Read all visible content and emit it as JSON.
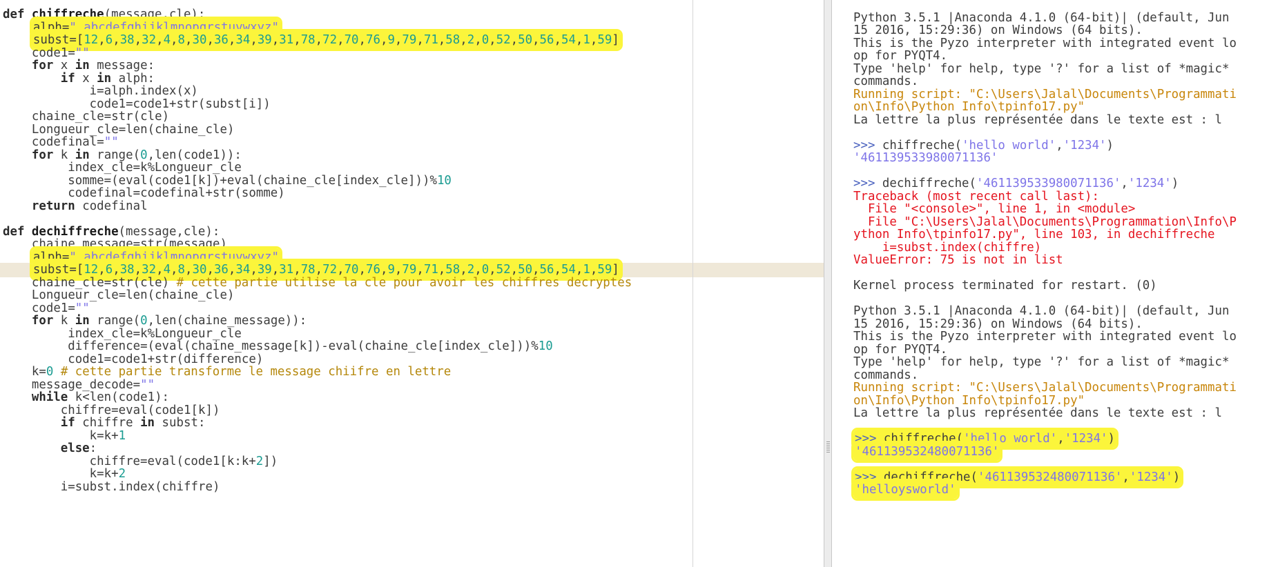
{
  "editor": {
    "lines": [
      "def chiffreche(message,cle):",
      "    alph=\" abcdefghijklmnopqrstuvwxyz\"",
      "    subst=[12,6,38,32,4,8,30,36,34,39,31,78,72,70,76,9,79,71,58,2,0,52,50,56,54,1,59]",
      "    code1=\"\"",
      "    for x in message:",
      "        if x in alph:",
      "            i=alph.index(x)",
      "            code1=code1+str(subst[i])",
      "    chaine_cle=str(cle)",
      "    Longueur_cle=len(chaine_cle)",
      "    codefinal=\"\"",
      "    for k in range(0,len(code1)):",
      "         index_cle=k%Longueur_cle",
      "         somme=(eval(code1[k])+eval(chaine_cle[index_cle]))%10",
      "         codefinal=codefinal+str(somme)",
      "    return codefinal",
      "",
      "def dechiffreche(message,cle):",
      "    chaine_message=str(message)",
      "    alph=\" abcdefghijklmnopqrstuvwxyz\"",
      "    subst=[12,6,38,32,4,8,30,36,34,39,31,78,72,70,76,9,79,71,58,2,0,52,50,56,54,1,59]",
      "    chaine_cle=str(cle) # cette partie utilise la cle pour avoir les chiffres decryptes",
      "    Longueur_cle=len(chaine_cle)",
      "    code1=\"\"",
      "    for k in range(0,len(chaine_message)):",
      "         index_cle=k%Longueur_cle",
      "         difference=(eval(chaine_message[k])-eval(chaine_cle[index_cle]))%10",
      "         code1=code1+str(difference)",
      "    k=0 # cette partie transforme le message chiifre en lettre",
      "    message_decode=\"\"",
      "    while k<len(code1):",
      "        chiffre=eval(code1[k])",
      "        if chiffre in subst:",
      "            k=k+1",
      "        else:",
      "            chiffre=eval(code1[k:k+2])",
      "            k=k+2",
      "        i=subst.index(chiffre)"
    ]
  },
  "shell": {
    "lines": [
      {
        "text": "Python 3.5.1 |Anaconda 4.1.0 (64-bit)| (default, Jun",
        "kind": "out"
      },
      {
        "text": "15 2016, 15:29:36) on Windows (64 bits).",
        "kind": "out"
      },
      {
        "text": "This is the Pyzo interpreter with integrated event lo",
        "kind": "out"
      },
      {
        "text": "op for PYQT4.",
        "kind": "out"
      },
      {
        "text": "Type 'help' for help, type '?' for a list of *magic*",
        "kind": "out"
      },
      {
        "text": "commands.",
        "kind": "out"
      },
      {
        "text": "Running script: \"C:\\Users\\Jalal\\Documents\\Programmati",
        "kind": "warn"
      },
      {
        "text": "on\\Info\\Python Info\\tpinfo17.py\"",
        "kind": "warn"
      },
      {
        "text": "La lettre la plus représentée dans le texte est : l",
        "kind": "out"
      },
      {
        "text": "",
        "kind": "out"
      },
      {
        "text": ">>> chiffreche('hello world','1234')",
        "kind": "prompt"
      },
      {
        "text": "'461139533980071136'",
        "kind": "result"
      },
      {
        "text": "",
        "kind": "out"
      },
      {
        "text": ">>> dechiffreche('461139533980071136','1234')",
        "kind": "prompt"
      },
      {
        "text": "Traceback (most recent call last):",
        "kind": "err"
      },
      {
        "text": "  File \"<console>\", line 1, in <module>",
        "kind": "err"
      },
      {
        "text": "  File \"C:\\Users\\Jalal\\Documents\\Programmation\\Info\\P",
        "kind": "err"
      },
      {
        "text": "ython Info\\tpinfo17.py\", line 103, in dechiffreche",
        "kind": "err"
      },
      {
        "text": "    i=subst.index(chiffre)",
        "kind": "err"
      },
      {
        "text": "ValueError: 75 is not in list",
        "kind": "err"
      },
      {
        "text": "",
        "kind": "out"
      },
      {
        "text": "Kernel process terminated for restart. (0)",
        "kind": "out"
      },
      {
        "text": "",
        "kind": "out"
      },
      {
        "text": "Python 3.5.1 |Anaconda 4.1.0 (64-bit)| (default, Jun",
        "kind": "out"
      },
      {
        "text": "15 2016, 15:29:36) on Windows (64 bits).",
        "kind": "out"
      },
      {
        "text": "This is the Pyzo interpreter with integrated event lo",
        "kind": "out"
      },
      {
        "text": "op for PYQT4.",
        "kind": "out"
      },
      {
        "text": "Type 'help' for help, type '?' for a list of *magic*",
        "kind": "out"
      },
      {
        "text": "commands.",
        "kind": "out"
      },
      {
        "text": "Running script: \"C:\\Users\\Jalal\\Documents\\Programmati",
        "kind": "warn"
      },
      {
        "text": "on\\Info\\Python Info\\tpinfo17.py\"",
        "kind": "warn"
      },
      {
        "text": "La lettre la plus représentée dans le texte est : l",
        "kind": "out"
      },
      {
        "text": "",
        "kind": "out"
      },
      {
        "text": ">>> chiffreche('hello world','1234')",
        "kind": "prompt"
      },
      {
        "text": "'461139532480071136'",
        "kind": "result"
      },
      {
        "text": "",
        "kind": "out"
      },
      {
        "text": ">>> dechiffreche('461139532480071136','1234')",
        "kind": "prompt"
      },
      {
        "text": "'helloysworld'",
        "kind": "result"
      }
    ]
  },
  "colors": {
    "highlight": "#fbf53b",
    "current_line": "#efe8d8",
    "error": "#e5141f",
    "string": "#7e74e8",
    "number": "#1b9c92",
    "comment": "#b5880c",
    "prompt": "#4b62bf"
  }
}
